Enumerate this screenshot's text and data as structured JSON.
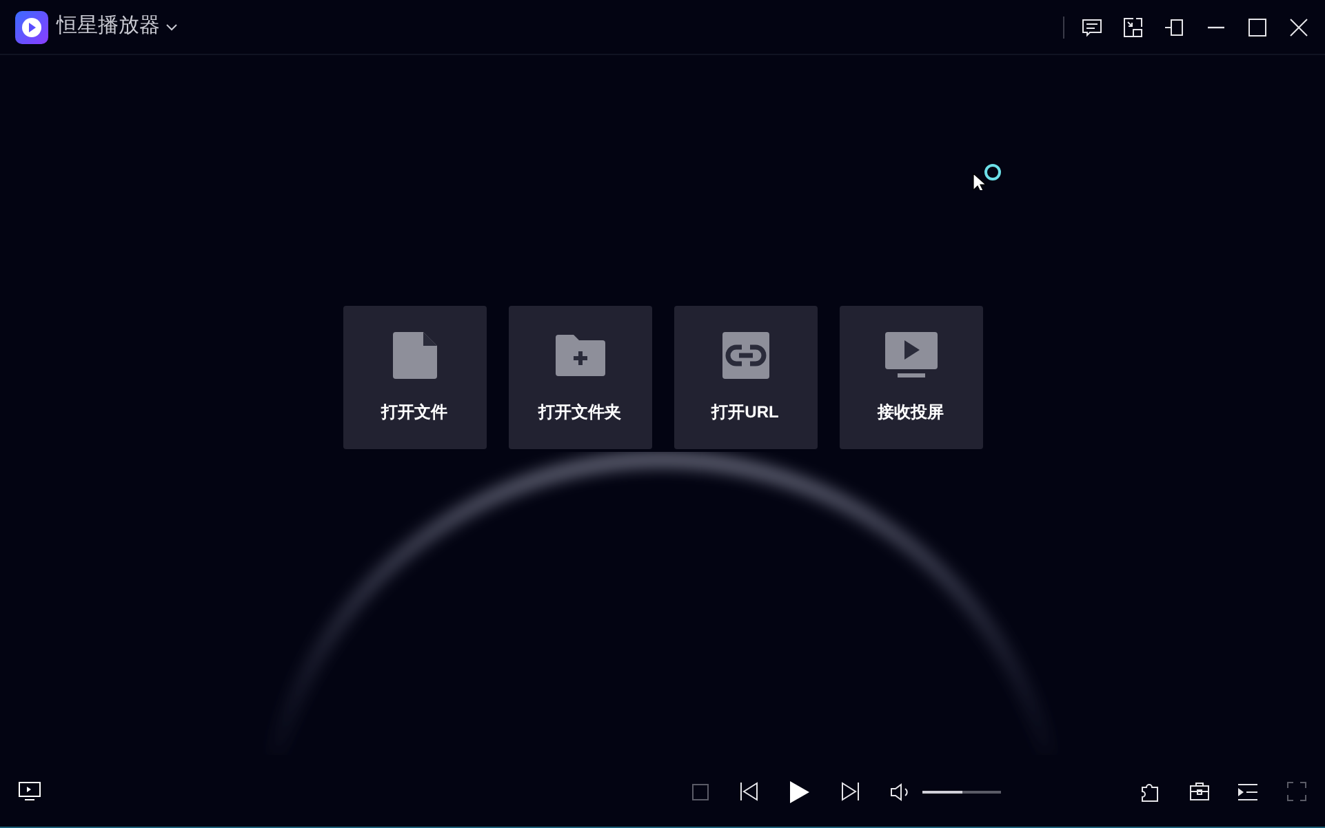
{
  "window": {
    "title": "恒星播放器"
  },
  "actions": [
    {
      "kind": "file",
      "label": "打开文件"
    },
    {
      "kind": "folder",
      "label": "打开文件夹"
    },
    {
      "kind": "url",
      "label": "打开URL"
    },
    {
      "kind": "cast",
      "label": "接收投屏"
    }
  ],
  "controls": {
    "stop_disabled": true,
    "volume": {
      "level": 0.5
    },
    "fullscreen_disabled": true
  }
}
